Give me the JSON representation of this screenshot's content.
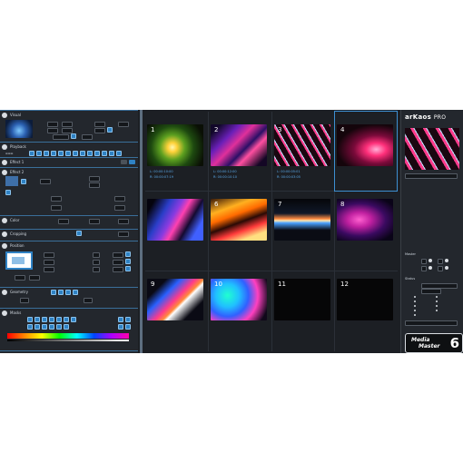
{
  "app": {
    "brand": "arKaos",
    "edition": "PRO"
  },
  "left_panel": {
    "sections": [
      {
        "id": "visual",
        "title": "Visual"
      },
      {
        "id": "playback",
        "title": "Playback"
      },
      {
        "id": "effect1",
        "title": "Effect 1"
      },
      {
        "id": "effect2",
        "title": "Effect 2"
      },
      {
        "id": "color",
        "title": "Color"
      },
      {
        "id": "cropping",
        "title": "Cropping"
      },
      {
        "id": "position",
        "title": "Position"
      },
      {
        "id": "geometry",
        "title": "Geometry"
      },
      {
        "id": "masks",
        "title": "Masks"
      }
    ]
  },
  "grid": {
    "cells": [
      {
        "num": "1",
        "line1": "L: 00:00:10:00",
        "line2": "R: 00:00:07:19",
        "selected": false
      },
      {
        "num": "2",
        "line1": "L: 00:00:12:00",
        "line2": "R: 00:00:10:10",
        "selected": false
      },
      {
        "num": "3",
        "line1": "L: 00:00:05:01",
        "line2": "R: 00:00:03:05",
        "selected": false
      },
      {
        "num": "4",
        "line1": "",
        "line2": "",
        "selected": true
      },
      {
        "num": "",
        "line1": "",
        "line2": "",
        "selected": false
      },
      {
        "num": "6",
        "line1": "",
        "line2": "",
        "selected": false
      },
      {
        "num": "7",
        "line1": "",
        "line2": "",
        "selected": false
      },
      {
        "num": "8",
        "line1": "",
        "line2": "",
        "selected": false
      },
      {
        "num": "9",
        "line1": "",
        "line2": "",
        "selected": false
      },
      {
        "num": "10",
        "line1": "",
        "line2": "",
        "selected": false
      },
      {
        "num": "11",
        "line1": "",
        "line2": "",
        "selected": false
      },
      {
        "num": "12",
        "line1": "",
        "line2": "",
        "selected": false
      }
    ]
  },
  "right_panel": {
    "master_title": "Master",
    "status_title": "Status"
  },
  "badge": {
    "line1": "Media",
    "line2": "Master",
    "version": "6"
  },
  "colors": {
    "accent": "#2f82c4",
    "panel": "#23272d",
    "background": "#1c1f24",
    "meta_text": "#5aa8e8"
  }
}
